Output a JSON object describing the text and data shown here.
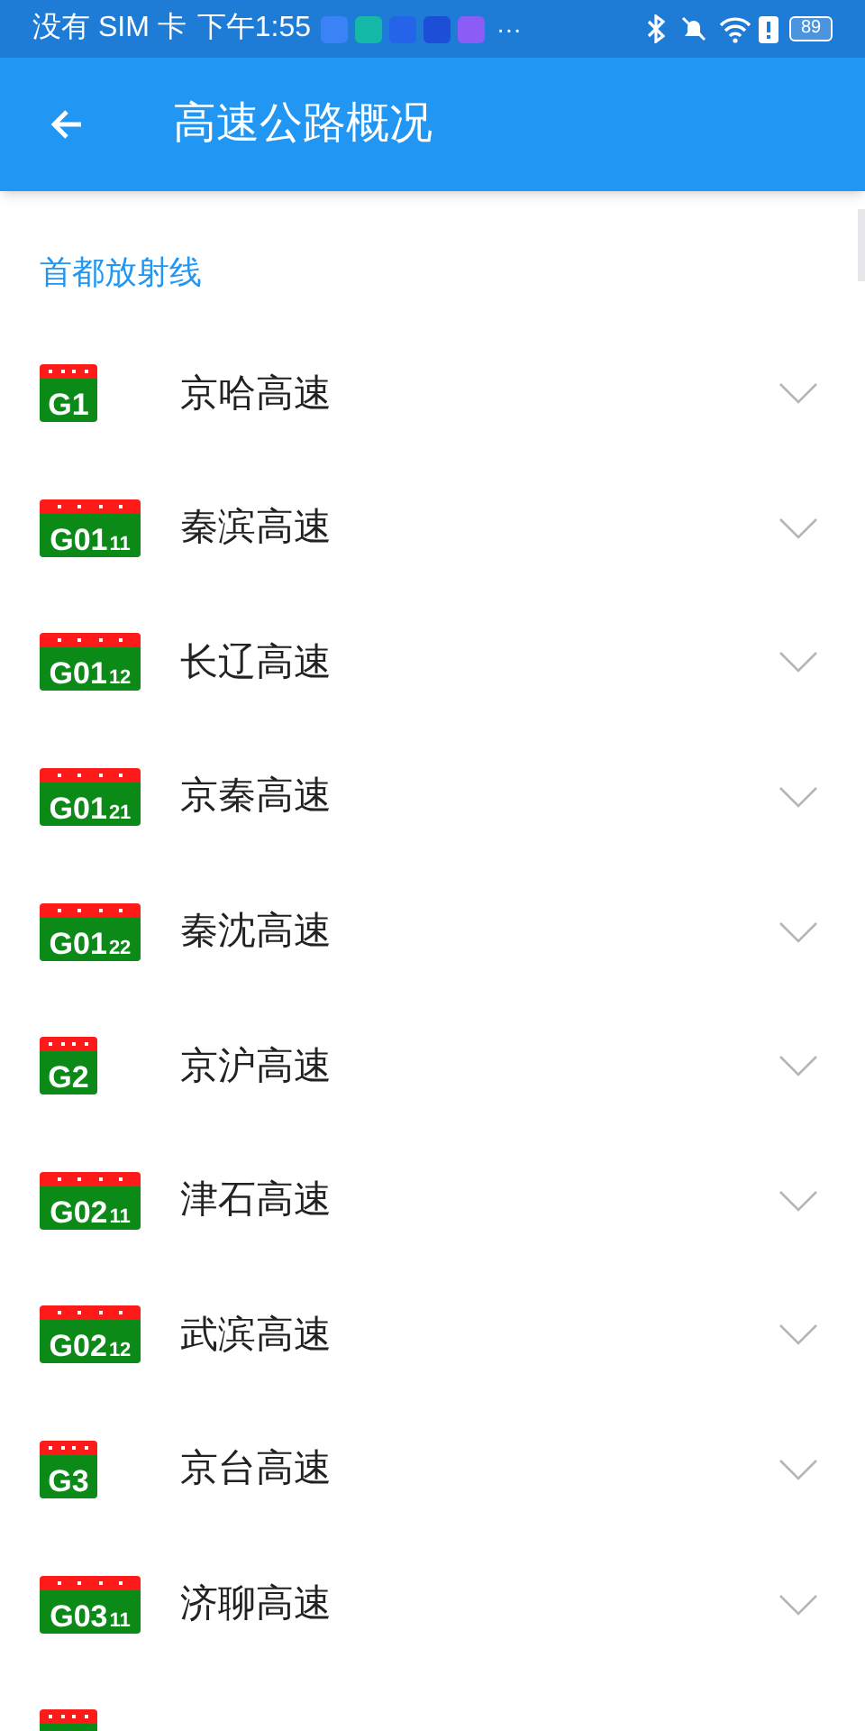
{
  "status_bar": {
    "carrier": "没有 SIM 卡",
    "time": "下午1:55",
    "more": "···",
    "battery": "89"
  },
  "app_bar": {
    "title": "高速公路概况"
  },
  "section": {
    "title": "首都放射线"
  },
  "roads": [
    {
      "code": "G1",
      "name": "京哈高速"
    },
    {
      "code": "G01",
      "sub": "11",
      "name": "秦滨高速"
    },
    {
      "code": "G01",
      "sub": "12",
      "name": "长辽高速"
    },
    {
      "code": "G01",
      "sub": "21",
      "name": "京秦高速"
    },
    {
      "code": "G01",
      "sub": "22",
      "name": "秦沈高速"
    },
    {
      "code": "G2",
      "name": "京沪高速"
    },
    {
      "code": "G02",
      "sub": "11",
      "name": "津石高速"
    },
    {
      "code": "G02",
      "sub": "12",
      "name": "武滨高速"
    },
    {
      "code": "G3",
      "name": "京台高速"
    },
    {
      "code": "G03",
      "sub": "11",
      "name": "济聊高速"
    },
    {
      "kind": "partial"
    }
  ]
}
